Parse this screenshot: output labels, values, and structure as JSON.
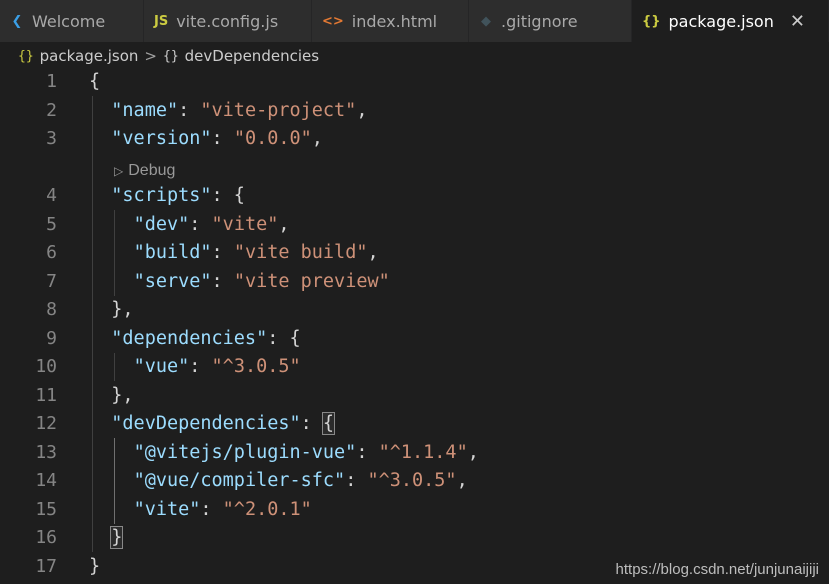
{
  "tabs": [
    {
      "label": "Welcome",
      "icon": "vscode-logo-icon",
      "glyph": "❮",
      "color": "#3b9fe6",
      "active": false
    },
    {
      "label": "vite.config.js",
      "icon": "js-file-icon",
      "glyph": "JS",
      "color": "#cbcb41",
      "active": false
    },
    {
      "label": "index.html",
      "icon": "html-file-icon",
      "glyph": "<>",
      "color": "#e37933",
      "active": false
    },
    {
      "label": ".gitignore",
      "icon": "git-file-icon",
      "glyph": "◆",
      "color": "#41535b",
      "active": false
    },
    {
      "label": "package.json",
      "icon": "json-file-icon",
      "glyph": "{}",
      "color": "#cbcb41",
      "active": true
    }
  ],
  "breadcrumb": {
    "file": "package.json",
    "file_glyph": "{}",
    "separator": ">",
    "symbol": "devDependencies",
    "symbol_glyph": "{}"
  },
  "codelens": {
    "label": "Debug",
    "glyph": "▷"
  },
  "line_numbers": [
    "1",
    "2",
    "3",
    "4",
    "5",
    "6",
    "7",
    "8",
    "9",
    "10",
    "11",
    "12",
    "13",
    "14",
    "15",
    "16",
    "17"
  ],
  "code_lines": [
    [
      {
        "t": "{",
        "c": "punct"
      }
    ],
    [
      {
        "t": "  ",
        "c": "punct"
      },
      {
        "t": "\"name\"",
        "c": "key"
      },
      {
        "t": ": ",
        "c": "punct"
      },
      {
        "t": "\"vite-project\"",
        "c": "str"
      },
      {
        "t": ",",
        "c": "punct"
      }
    ],
    [
      {
        "t": "  ",
        "c": "punct"
      },
      {
        "t": "\"version\"",
        "c": "key"
      },
      {
        "t": ": ",
        "c": "punct"
      },
      {
        "t": "\"0.0.0\"",
        "c": "str"
      },
      {
        "t": ",",
        "c": "punct"
      }
    ],
    [
      {
        "t": "  ",
        "c": "punct"
      },
      {
        "t": "\"scripts\"",
        "c": "key"
      },
      {
        "t": ": {",
        "c": "punct"
      }
    ],
    [
      {
        "t": "    ",
        "c": "punct"
      },
      {
        "t": "\"dev\"",
        "c": "key"
      },
      {
        "t": ": ",
        "c": "punct"
      },
      {
        "t": "\"vite\"",
        "c": "str"
      },
      {
        "t": ",",
        "c": "punct"
      }
    ],
    [
      {
        "t": "    ",
        "c": "punct"
      },
      {
        "t": "\"build\"",
        "c": "key"
      },
      {
        "t": ": ",
        "c": "punct"
      },
      {
        "t": "\"vite build\"",
        "c": "str"
      },
      {
        "t": ",",
        "c": "punct"
      }
    ],
    [
      {
        "t": "    ",
        "c": "punct"
      },
      {
        "t": "\"serve\"",
        "c": "key"
      },
      {
        "t": ": ",
        "c": "punct"
      },
      {
        "t": "\"vite preview\"",
        "c": "str"
      }
    ],
    [
      {
        "t": "  },",
        "c": "punct"
      }
    ],
    [
      {
        "t": "  ",
        "c": "punct"
      },
      {
        "t": "\"dependencies\"",
        "c": "key"
      },
      {
        "t": ": {",
        "c": "punct"
      }
    ],
    [
      {
        "t": "    ",
        "c": "punct"
      },
      {
        "t": "\"vue\"",
        "c": "key"
      },
      {
        "t": ": ",
        "c": "punct"
      },
      {
        "t": "\"^3.0.5\"",
        "c": "str"
      }
    ],
    [
      {
        "t": "  },",
        "c": "punct"
      }
    ],
    [
      {
        "t": "  ",
        "c": "punct"
      },
      {
        "t": "\"devDependencies\"",
        "c": "key"
      },
      {
        "t": ": ",
        "c": "punct"
      },
      {
        "t": "{",
        "c": "punct bracket-match"
      }
    ],
    [
      {
        "t": "    ",
        "c": "punct"
      },
      {
        "t": "\"@vitejs/plugin-vue\"",
        "c": "key"
      },
      {
        "t": ": ",
        "c": "punct"
      },
      {
        "t": "\"^1.1.4\"",
        "c": "str"
      },
      {
        "t": ",",
        "c": "punct"
      }
    ],
    [
      {
        "t": "    ",
        "c": "punct"
      },
      {
        "t": "\"@vue/compiler-sfc\"",
        "c": "key"
      },
      {
        "t": ": ",
        "c": "punct"
      },
      {
        "t": "\"^3.0.5\"",
        "c": "str"
      },
      {
        "t": ",",
        "c": "punct"
      }
    ],
    [
      {
        "t": "    ",
        "c": "punct"
      },
      {
        "t": "\"vite\"",
        "c": "key"
      },
      {
        "t": ": ",
        "c": "punct"
      },
      {
        "t": "\"^2.0.1\"",
        "c": "str"
      }
    ],
    [
      {
        "t": "  ",
        "c": "punct"
      },
      {
        "t": "}",
        "c": "punct bracket-match"
      }
    ],
    [
      {
        "t": "}",
        "c": "punct"
      }
    ]
  ],
  "watermark": "https://blog.csdn.net/junjunaijiji"
}
